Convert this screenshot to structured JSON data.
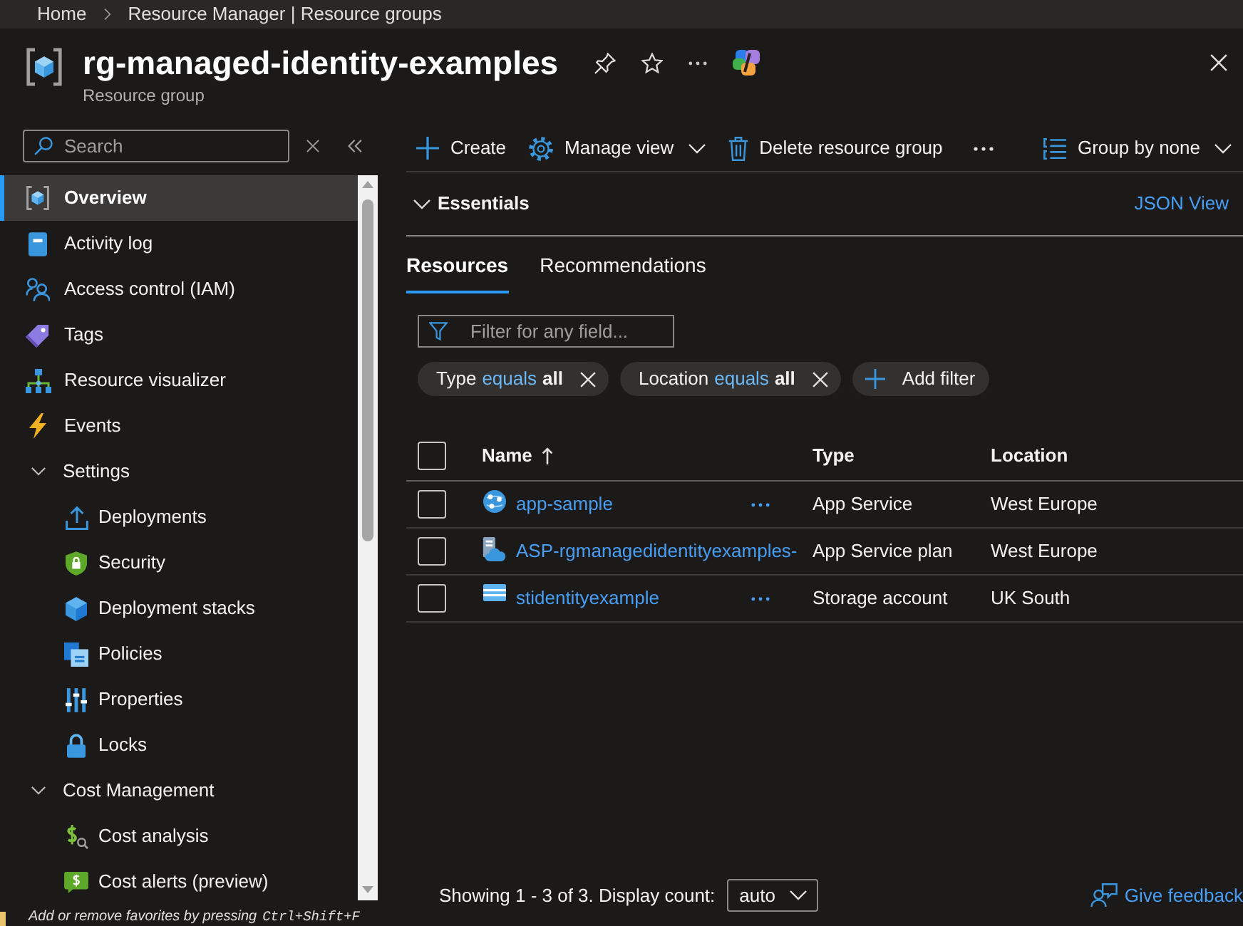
{
  "breadcrumb": [
    {
      "label": "Home"
    },
    {
      "label": "Resource Manager | Resource groups"
    }
  ],
  "header": {
    "title": "rg-managed-identity-examples",
    "subtitle": "Resource group"
  },
  "sidebar": {
    "search": {
      "placeholder": "Search"
    },
    "items": [
      {
        "label": "Overview",
        "selected": true
      },
      {
        "label": "Activity log",
        "selected": false
      },
      {
        "label": "Access control (IAM)",
        "selected": false
      },
      {
        "label": "Tags",
        "selected": false
      },
      {
        "label": "Resource visualizer",
        "selected": false
      },
      {
        "label": "Events",
        "selected": false
      },
      {
        "label": "Settings",
        "selected": false,
        "expanded": true,
        "children": [
          {
            "label": "Deployments",
            "selected": false
          },
          {
            "label": "Security",
            "selected": false
          },
          {
            "label": "Deployment stacks",
            "selected": false
          },
          {
            "label": "Policies",
            "selected": false
          },
          {
            "label": "Properties",
            "selected": false
          },
          {
            "label": "Locks",
            "selected": false
          }
        ]
      },
      {
        "label": "Cost Management",
        "selected": false,
        "expanded": true,
        "children": [
          {
            "label": "Cost analysis",
            "selected": false
          },
          {
            "label": "Cost alerts (preview)",
            "selected": false
          }
        ]
      }
    ],
    "tip": {
      "text": "Add or remove favorites by pressing",
      "shortcut": "Ctrl+Shift+F"
    }
  },
  "toolbar": {
    "items": [
      {
        "kind": "button",
        "label": "Create",
        "dropdown": false
      },
      {
        "kind": "button",
        "label": "Manage view",
        "dropdown": true
      },
      {
        "kind": "button",
        "label": "Delete resource group",
        "dropdown": false
      },
      {
        "kind": "more"
      }
    ],
    "group_by": {
      "label": "Group by none",
      "dropdown": true
    }
  },
  "essentials": {
    "label": "Essentials",
    "expanded": false,
    "link": "JSON View"
  },
  "tabs": [
    {
      "label": "Resources",
      "selected": true
    },
    {
      "label": "Recommendations",
      "selected": false
    }
  ],
  "filter": {
    "placeholder": "Filter for any field..."
  },
  "filter_pills": [
    {
      "field": "Type",
      "operator": "equals",
      "value": "all"
    },
    {
      "field": "Location",
      "operator": "equals",
      "value": "all"
    }
  ],
  "add_filter": {
    "label": "Add filter"
  },
  "table": {
    "select_all_checked": false,
    "columns": [
      {
        "label": "Name",
        "sorted": true,
        "descending": false
      },
      {
        "label": "Type",
        "sorted": false
      },
      {
        "label": "Location",
        "sorted": false
      }
    ],
    "rows": [
      {
        "checked": false,
        "name": "app-sample",
        "more_button": true,
        "type": "App Service",
        "location": "West Europe"
      },
      {
        "checked": false,
        "name": "ASP-rgmanagedidentityexamples-",
        "more_button": false,
        "type": "App Service plan",
        "location": "West Europe"
      },
      {
        "checked": false,
        "name": "stidentityexample",
        "more_button": true,
        "type": "Storage account",
        "location": "UK South"
      }
    ]
  },
  "footer": {
    "summary": "Showing 1 - 3 of 3. Display count:",
    "display_count": "auto",
    "feedback": "Give feedback"
  }
}
